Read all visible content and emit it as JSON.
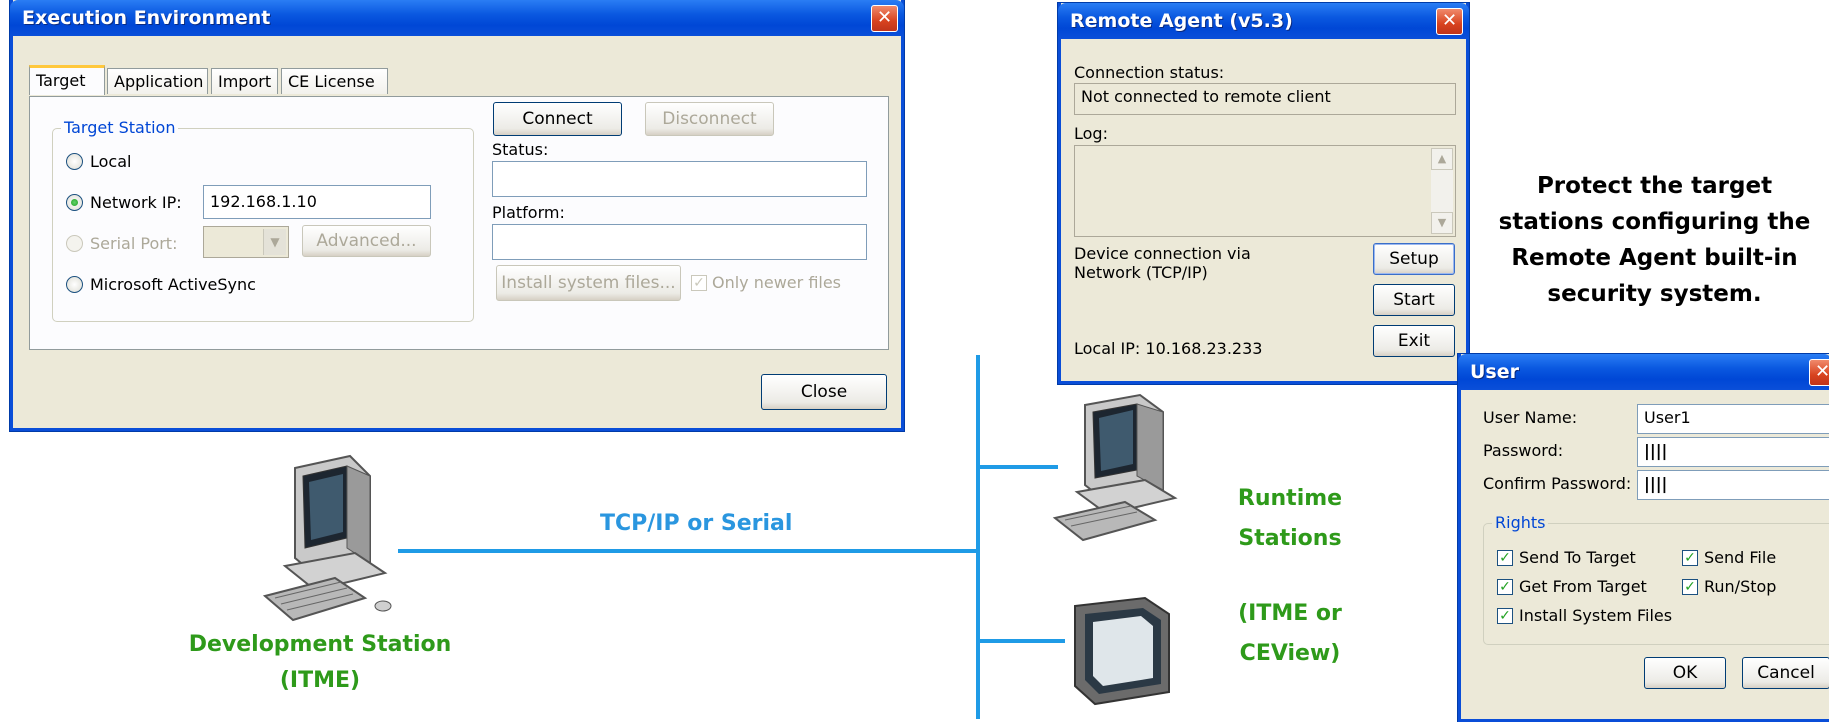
{
  "exec_env": {
    "title": "Execution Environment",
    "close_glyph": "✕",
    "tabs": [
      "Target",
      "Application",
      "Import",
      "CE License"
    ],
    "group_title": "Target Station",
    "radio_local": "Local",
    "radio_network": "Network IP:",
    "network_ip": "192.168.1.10",
    "radio_serial": "Serial Port:",
    "advanced_label": "Advanced...",
    "radio_activesync": "Microsoft ActiveSync",
    "connect_label": "Connect",
    "disconnect_label": "Disconnect",
    "status_label": "Status:",
    "status_value": "",
    "platform_label": "Platform:",
    "platform_value": "",
    "install_label": "Install system files...",
    "only_newer_label": "Only newer files",
    "close_label": "Close",
    "selected_radio": "network"
  },
  "remote_agent": {
    "title": "Remote Agent (v5.3)",
    "close_glyph": "✕",
    "connection_status_label": "Connection status:",
    "connection_status_value": "Not connected to remote client",
    "log_label": "Log:",
    "device_connection_line1": "Device connection via",
    "device_connection_line2": "Network (TCP/IP)",
    "setup_label": "Setup",
    "start_label": "Start",
    "exit_label": "Exit",
    "local_ip": "Local IP: 10.168.23.233"
  },
  "user_dialog": {
    "title": "User",
    "close_glyph": "✕",
    "user_name_label": "User Name:",
    "user_name_value": "User1",
    "password_label": "Password:",
    "password_value": "||||",
    "confirm_label": "Confirm Password:",
    "confirm_value": "||||",
    "rights_title": "Rights",
    "rights": {
      "send_to_target": "Send To Target",
      "send_file": "Send File",
      "get_from_target": "Get From Target",
      "run_stop": "Run/Stop",
      "install_system_files": "Install System Files"
    },
    "ok_label": "OK",
    "cancel_label": "Cancel"
  },
  "diagram": {
    "protect_text_l1": "Protect the target",
    "protect_text_l2": "stations configuring the",
    "protect_text_l3": "Remote Agent built-in",
    "protect_text_l4": "security system.",
    "link_label": "TCP/IP or Serial",
    "dev_station_l1": "Development Station",
    "dev_station_l2": "(ITME)",
    "runtime_l1": "Runtime",
    "runtime_l2": "Stations",
    "runtime_l3": "(ITME or",
    "runtime_l4": "CEView)"
  },
  "colors": {
    "xp_title_blue": "#0a58e0",
    "label_green": "#2e9a1a",
    "label_blue": "#2a96df",
    "line_blue": "#1f9be6"
  }
}
